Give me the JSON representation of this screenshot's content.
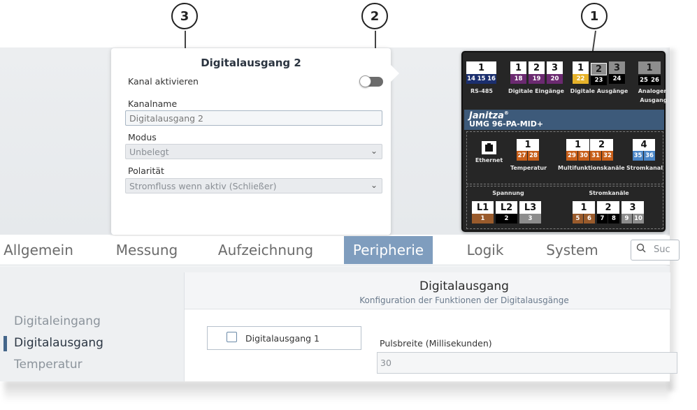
{
  "callouts": [
    "3",
    "2",
    "1"
  ],
  "config": {
    "title": "Digitalausgang 2",
    "enable_label": "Kanal aktivieren",
    "enabled": false,
    "name_label": "Kanalname",
    "name_value": "Digitalausgang 2",
    "mode_label": "Modus",
    "mode_value": "Unbelegt",
    "polarity_label": "Polarität",
    "polarity_value": "Stromfluss wenn aktiv (Schließer)"
  },
  "device": {
    "brand": "Janitza",
    "brand_mark": "®",
    "model": "UMG 96-PA-MID+",
    "top": {
      "rs485": {
        "num": "1",
        "pins": [
          "14",
          "15",
          "16"
        ],
        "label": "RS-485"
      },
      "inputs": {
        "nums": [
          "1",
          "2",
          "3"
        ],
        "pins": [
          "18",
          "19",
          "20"
        ],
        "label": "Digitale Eingänge"
      },
      "outputs": {
        "nums": [
          "1",
          "2",
          "3"
        ],
        "pins": [
          "22",
          "23",
          "24"
        ],
        "label": "Digitale Ausgänge"
      },
      "analog": {
        "num": "1",
        "pins": [
          "25",
          "26"
        ],
        "label_line1": "Analoger",
        "label_line2": "Ausgang"
      }
    },
    "middle": {
      "ethernet_label": "Ethernet",
      "temp": {
        "num": "1",
        "pins": [
          "27",
          "28"
        ],
        "label": "Temperatur"
      },
      "multi": {
        "nums": [
          "1",
          "2"
        ],
        "pins": [
          "29",
          "30",
          "31",
          "32"
        ],
        "label": "Multifunktionskanäle"
      },
      "current": {
        "num": "4",
        "pins": [
          "35",
          "36"
        ],
        "label": "Stromkanal"
      }
    },
    "bottom": {
      "voltage_label": "Spannung",
      "voltage": {
        "nums": [
          "L1",
          "L2",
          "L3"
        ],
        "pins": [
          "1",
          "2",
          "3"
        ]
      },
      "current_label": "Stromkanäle",
      "current": {
        "nums": [
          "1",
          "2",
          "3"
        ],
        "pins": [
          "5",
          "6",
          "7",
          "8",
          "9",
          "10"
        ]
      }
    },
    "colors": {
      "navy": "#1b2f6e",
      "purple": "#6b2a70",
      "yellow": "#e6b22a",
      "orange": "#c85f1a",
      "blue": "#4a86c7",
      "brown": "#9a5b2c",
      "black": "#000000",
      "grey": "#8d8d8d"
    }
  },
  "tabs": [
    "Allgemein",
    "Messung",
    "Aufzeichnung",
    "Peripherie",
    "Logik",
    "System"
  ],
  "active_tab": "Peripherie",
  "search_placeholder": "Suc",
  "sidebar": [
    "Digitaleingang",
    "Digitalausgang",
    "Temperatur"
  ],
  "active_sidebar": "Digitalausgang",
  "main": {
    "title": "Digitalausgang",
    "subtitle": "Konfiguration der Funktionen der Digitalausgänge",
    "channel_label": "Digitalausgang 1",
    "pulse_label": "Pulsbreite (Millisekunden)",
    "pulse_value": "30"
  }
}
